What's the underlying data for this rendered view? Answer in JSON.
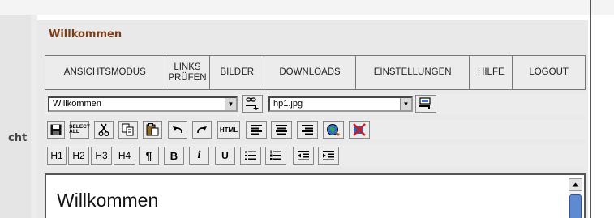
{
  "left_panel": {
    "cut_label": "cht"
  },
  "panel": {
    "title": "Willkommen"
  },
  "menu": [
    {
      "label": "ANSICHTSMODUS"
    },
    {
      "label": "LINKS\nPRÜFEN"
    },
    {
      "label": "BILDER"
    },
    {
      "label": "DOWNLOADS"
    },
    {
      "label": "EINSTELLUNGEN"
    },
    {
      "label": "HILFE"
    },
    {
      "label": "LOGOUT"
    }
  ],
  "toolbar_row1": {
    "page_select": {
      "value": "Willkommen"
    },
    "image_select": {
      "value": "hp1.jpg"
    }
  },
  "toolbar_row2": {
    "select_all_label": "SELECT\nALL",
    "html_label": "HTML"
  },
  "toolbar_row3": {
    "h1": "H1",
    "h2": "H2",
    "h3": "H3",
    "h4": "H4",
    "pilcrow": "¶",
    "bold": "B",
    "italic": "i",
    "underline": "U"
  },
  "editor": {
    "heading_text": "Willkommen"
  },
  "colors": {
    "title": "#7a3f1a",
    "scroll_thumb": "#5d8ad1",
    "panel_bg": "#e9e9e9"
  }
}
